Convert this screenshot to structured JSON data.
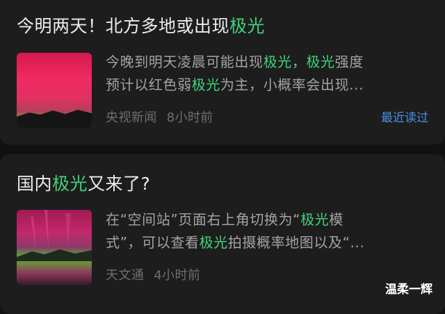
{
  "colors": {
    "background": "#111111",
    "card": "#1d1d1d",
    "title_text": "#ececec",
    "highlight": "#3fd27a",
    "snippet_text": "#a3a3a3",
    "meta_text": "#6f6f6f",
    "recent_read": "#4a8fe3"
  },
  "feed": [
    {
      "title": {
        "before": "今明两天！北方多地或出现",
        "highlight": "极光",
        "after": ""
      },
      "snippet": {
        "line1": {
          "a": "今晚到明天凌晨可能出现",
          "h1": "极光",
          "b": "，",
          "h2": "极光",
          "c": "强度"
        },
        "line2": {
          "a": "预计以红色弱",
          "h1": "极光",
          "b": "为主，小概率会出现..."
        }
      },
      "source": "央视新闻",
      "time": "8小时前",
      "recent_label": "最近读过",
      "thumbnail_icon": "red-aurora-photo"
    },
    {
      "title": {
        "before": "国内",
        "highlight": "极光",
        "after": "又来了?"
      },
      "snippet": {
        "line1": {
          "a": "在“空间站”页面右上角切换为“",
          "h1": "极光",
          "b": "模"
        },
        "line2": {
          "a": "式”，可以查看",
          "h1": "极光",
          "b": "拍摄概率地图以及“..."
        }
      },
      "source": "天文通",
      "time": "4小时前",
      "thumbnail_icon": "green-red-aurora-photo"
    }
  ],
  "watermark": "温柔一辉"
}
